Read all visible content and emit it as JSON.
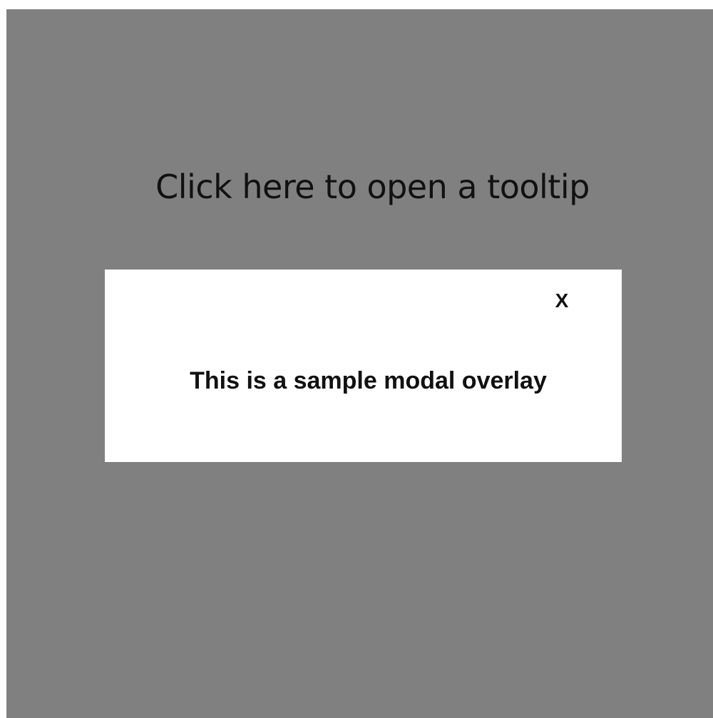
{
  "page": {
    "trigger_text": "Click here to open a tooltip"
  },
  "modal": {
    "close_label": "X",
    "message": "This is a sample modal overlay"
  },
  "colors": {
    "backdrop": "#808080",
    "modal_background": "#ffffff",
    "text": "#111111"
  }
}
